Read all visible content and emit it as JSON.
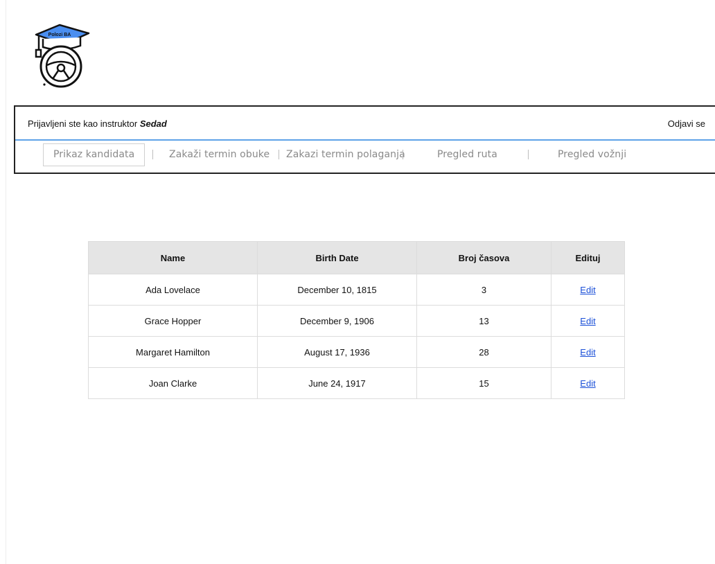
{
  "logo": {
    "name": "graduation-cap-steering-wheel-logo",
    "text": "Polozi BA",
    "accent_color": "#4a8ef0"
  },
  "header": {
    "login_prefix": "Prijavljeni ste kao instruktor ",
    "username": "Sedad",
    "logout_label": "Odjavi se",
    "accent_line_color": "#5ea2e8"
  },
  "nav": {
    "items": [
      {
        "label": "Prikaz kandidata",
        "active": true
      },
      {
        "label": "Zakaži termin obuke",
        "active": false
      },
      {
        "label": "Zakazi termin polaganja",
        "active": false
      },
      {
        "label": "Pregled ruta",
        "active": false
      },
      {
        "label": "Pregled vožnji",
        "active": false
      }
    ]
  },
  "table": {
    "headers": [
      "Name",
      "Birth Date",
      "Broj časova",
      "Edituj"
    ],
    "rows": [
      {
        "name": "Ada Lovelace",
        "birth_date": "December 10, 1815",
        "hours": "3",
        "action": "Edit"
      },
      {
        "name": "Grace Hopper",
        "birth_date": "December 9, 1906",
        "hours": "13",
        "action": "Edit"
      },
      {
        "name": "Margaret Hamilton",
        "birth_date": "August 17, 1936",
        "hours": "28",
        "action": "Edit"
      },
      {
        "name": "Joan Clarke",
        "birth_date": "June 24, 1917",
        "hours": "15",
        "action": "Edit"
      }
    ],
    "link_color": "#1a4fd8",
    "header_bg": "#e5e5e5"
  }
}
